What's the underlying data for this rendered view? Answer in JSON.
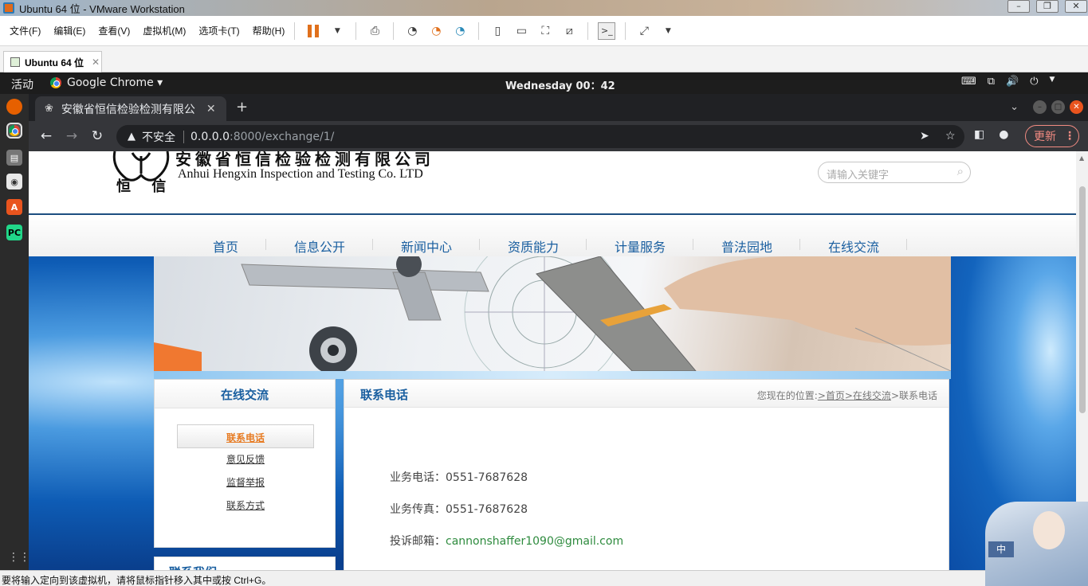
{
  "vmware": {
    "window_title": "Ubuntu 64 位 - VMware Workstation",
    "menu": [
      "文件(F)",
      "编辑(E)",
      "查看(V)",
      "虚拟机(M)",
      "选项卡(T)",
      "帮助(H)"
    ],
    "tab_label": "Ubuntu 64 位",
    "status_text": "要将输入定向到该虚拟机，请将鼠标指针移入其中或按 Ctrl+G。"
  },
  "ubuntu": {
    "activities": "活动",
    "app_name": "Google Chrome ▾",
    "clock": "Wednesday 00：42"
  },
  "chrome": {
    "tab_title": "安徽省恒信检验检测有限公",
    "security_label": "不安全",
    "url_host": "0.0.0.0",
    "url_path": ":8000/exchange/1/",
    "update_label": "更新"
  },
  "site": {
    "logo_cn": "安徽省恒信检验检测有限公司",
    "logo_en": "Anhui Hengxin Inspection and Testing Co. LTD",
    "logo_glyphs": "恒 信",
    "search_placeholder": "请输入关键字",
    "nav": [
      "首页",
      "信息公开",
      "新闻中心",
      "资质能力",
      "计量服务",
      "普法园地",
      "在线交流"
    ],
    "sidebar": {
      "title": "在线交流",
      "links": [
        "联系电话",
        "意见反馈",
        "监督举报",
        "联系方式"
      ],
      "active_index": 0,
      "title2": "联系我们"
    },
    "main": {
      "title": "联系电话",
      "breadcrumb_prefix": "您现在的位置:",
      "breadcrumb_home": ">首页",
      "breadcrumb_section": ">在线交流",
      "breadcrumb_current": ">联系电话",
      "phone_label": "业务电话：",
      "phone_value": "0551-7687628",
      "fax_label": "业务传真：",
      "fax_value": "0551-7687628",
      "email_label": "投诉邮箱：",
      "email_value": "cannonshaffer1090@gmail.com"
    },
    "mascot_tag": "中"
  },
  "colors": {
    "nav_blue": "#1a5fa0",
    "active_orange": "#e77b22",
    "email_green": "#2e8b3e",
    "header_rule": "#1c4e80"
  }
}
